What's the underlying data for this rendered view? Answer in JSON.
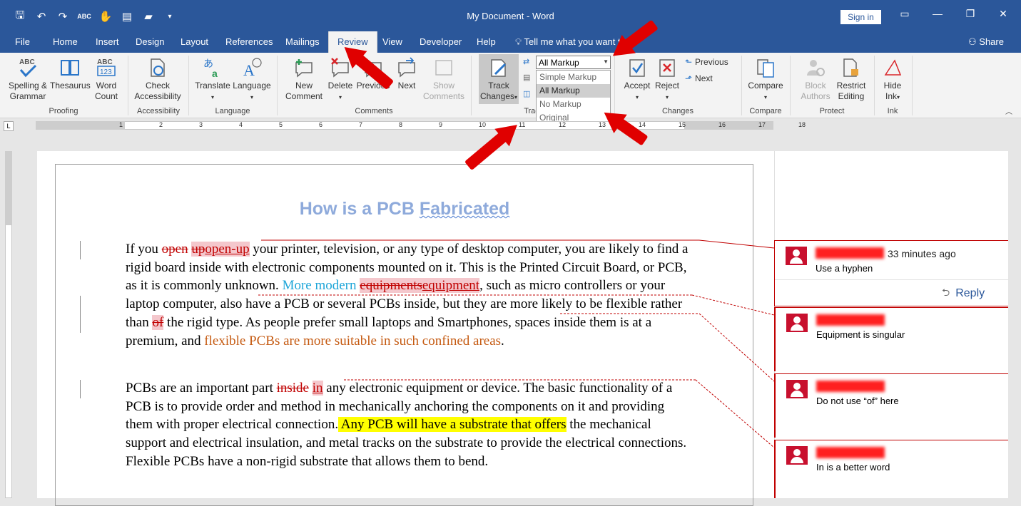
{
  "window": {
    "title": "My Document  -  Word",
    "signin": "Sign in",
    "share": "Share"
  },
  "tabs": [
    "File",
    "Home",
    "Insert",
    "Design",
    "Layout",
    "References",
    "Mailings",
    "Review",
    "View",
    "Developer",
    "Help"
  ],
  "tellme": "Tell me what you want to do",
  "ribbon": {
    "spelling": "Spelling &\nGrammar",
    "thesaurus": "Thesaurus",
    "wordcount": "Word\nCount",
    "check": "Check\nAccessibility",
    "translate": "Translate",
    "language": "Language",
    "newcomment": "New\nComment",
    "delete": "Delete",
    "previous": "Previous",
    "next": "Next",
    "showcomments": "Show\nComments",
    "trackchanges": "Track\nChanges",
    "markup_value": "All Markup",
    "markup_options": [
      "Simple Markup",
      "All Markup",
      "No Markup",
      "Original"
    ],
    "accept": "Accept",
    "reject": "Reject",
    "prev_change": "Previous",
    "next_change": "Next",
    "compare": "Compare",
    "block": "Block\nAuthors",
    "restrict": "Restrict\nEditing",
    "hideink": "Hide\nInk",
    "groups": {
      "proofing": "Proofing",
      "accessibility": "Accessibility",
      "language": "Language",
      "comments": "Comments",
      "tracking": "Trac",
      "changes": "Changes",
      "compare": "Compare",
      "protect": "Protect",
      "ink": "Ink"
    }
  },
  "document": {
    "heading_a": "How is a PCB ",
    "heading_b": "Fabricated",
    "p1": {
      "a": "If you ",
      "del1": "open",
      "sp": " ",
      "del2": "up",
      "ins1": "open-up",
      "b": " your printer, television, or any type of desktop computer, you are likely to find a rigid board inside with electronic components mounted on it. This is the Printed Circuit Board, or PCB, as it is commonly unknown. ",
      "moved": "More modern",
      "sp2": " ",
      "del3": "equipments",
      "ins2": "equipment",
      "c": ", such as micro controllers or your laptop computer, also have a PCB or several PCBs inside, but they are more likely to be flexible rather than ",
      "del4": "of",
      "d": " the rigid type. As people prefer small laptops and Smartphones, spaces inside them is at a premium, and ",
      "fmt": "flexible PCBs are more suitable in such confined areas",
      "e": "."
    },
    "p2": {
      "a": "PCBs are an important part ",
      "del1": "inside",
      "sp": " ",
      "ins1": "in",
      "b": " any electronic equipment or device. The basic functionality of a PCB is to provide order and method in mechanically anchoring the components on it and providing them with proper electrical connection.",
      "hl": " Any PCB will have a substrate that offers",
      "c": " the mechanical support and electrical insulation, and metal tracks on the substrate to provide the electrical connections. Flexible PCBs have a non-rigid substrate that allows them to bend."
    }
  },
  "comments": [
    {
      "time": "33 minutes ago",
      "text": "Use a hyphen"
    },
    {
      "time": "",
      "text": "Equipment is singular"
    },
    {
      "time": "",
      "text": "Do not use “of” here"
    },
    {
      "time": "",
      "text": "In is a better word"
    }
  ],
  "reply": "Reply",
  "ruler_numbers": [
    "1",
    "2",
    "3",
    "4",
    "5",
    "6",
    "7",
    "8",
    "9",
    "10",
    "11",
    "12",
    "13",
    "14",
    "15",
    "16",
    "17",
    "18"
  ]
}
